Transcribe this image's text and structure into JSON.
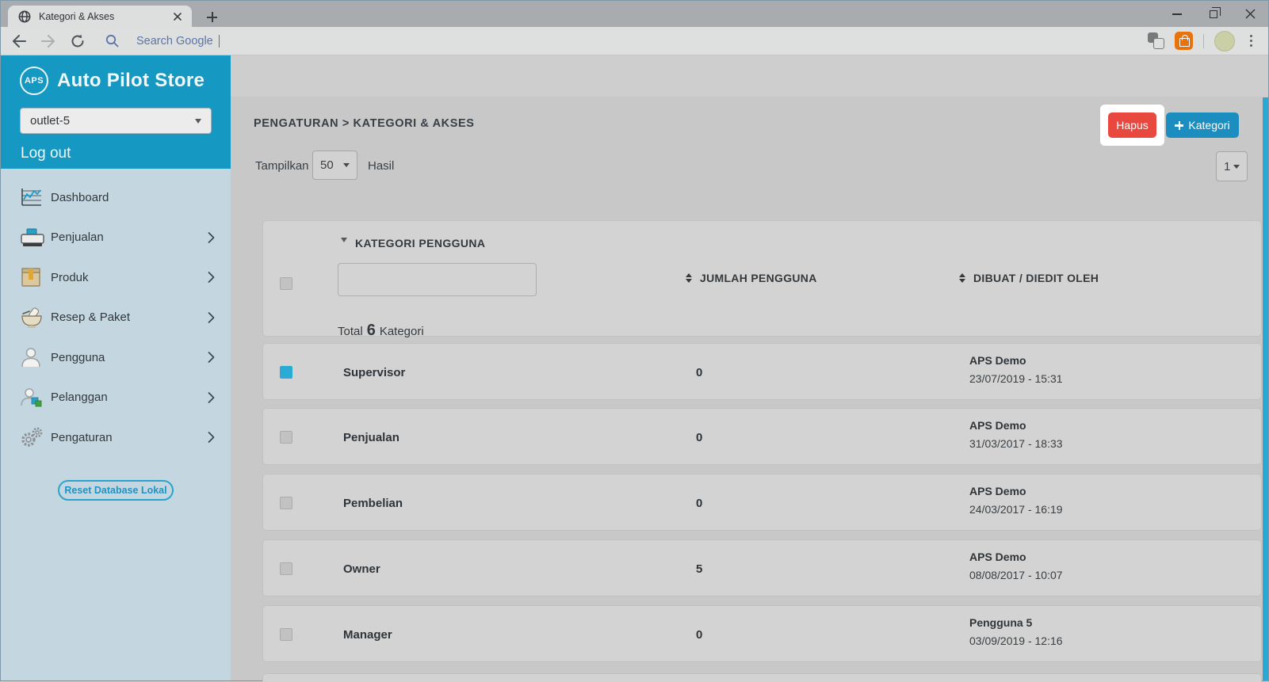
{
  "browser": {
    "tab": {
      "title": "Kategori & Akses"
    },
    "address": {
      "placeholder": "Search Google"
    }
  },
  "sidebar": {
    "logo_text": "APS",
    "brand": "Auto Pilot Store",
    "outlet": "outlet-5",
    "logout": "Log out",
    "items": [
      {
        "label": "Dashboard"
      },
      {
        "label": "Penjualan"
      },
      {
        "label": "Produk"
      },
      {
        "label": "Resep & Paket"
      },
      {
        "label": "Pengguna"
      },
      {
        "label": "Pelanggan"
      },
      {
        "label": "Pengaturan"
      }
    ],
    "reset_button": "Reset Database Lokal"
  },
  "main": {
    "breadcrumb": "PENGATURAN > KATEGORI & AKSES",
    "delete_button": "Hapus",
    "add_button": "Kategori",
    "show_label": "Tampilkan",
    "show_value": "50",
    "results_label": "Hasil",
    "page_value": "1",
    "table": {
      "columns": {
        "category": "KATEGORI PENGGUNA",
        "count": "JUMLAH PENGGUNA",
        "edited_by": "DIBUAT / DIEDIT OLEH"
      },
      "filter_value": "",
      "total_prefix": "Total",
      "total_count": "6",
      "total_suffix": "Kategori",
      "rows": [
        {
          "name": "Supervisor",
          "count": "0",
          "by": "APS Demo",
          "date": "23/07/2019 - 15:31",
          "checked": true
        },
        {
          "name": "Penjualan",
          "count": "0",
          "by": "APS Demo",
          "date": "31/03/2017 - 18:33",
          "checked": false
        },
        {
          "name": "Pembelian",
          "count": "0",
          "by": "APS Demo",
          "date": "24/03/2017 - 16:19",
          "checked": false
        },
        {
          "name": "Owner",
          "count": "5",
          "by": "APS Demo",
          "date": "08/08/2017 - 10:07",
          "checked": false
        },
        {
          "name": "Manager",
          "count": "0",
          "by": "Pengguna 5",
          "date": "03/09/2019 - 12:16",
          "checked": false
        }
      ]
    }
  },
  "colors": {
    "sidebar_header": "#1598C2",
    "accent_blue": "#1B8DBE",
    "danger_red": "#E8483D",
    "selection_cyan": "#2BAAD5"
  }
}
